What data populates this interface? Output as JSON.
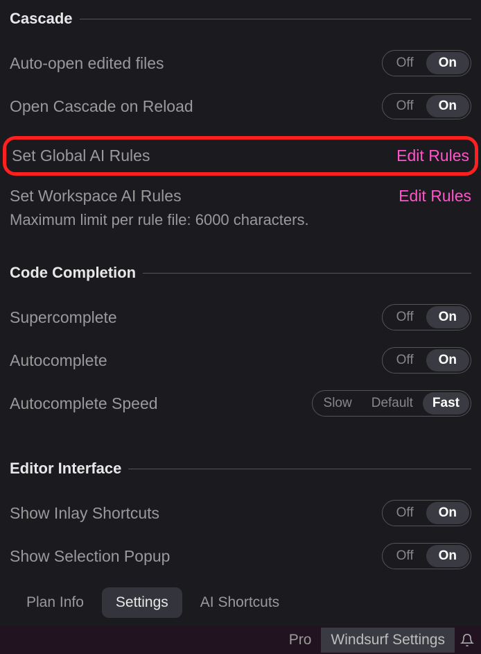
{
  "sections": {
    "cascade": {
      "title": "Cascade",
      "auto_open_label": "Auto-open edited files",
      "open_on_reload_label": "Open Cascade on Reload",
      "global_rules_label": "Set Global AI Rules",
      "global_rules_link": "Edit Rules",
      "workspace_rules_label": "Set Workspace AI Rules",
      "workspace_rules_link": "Edit Rules",
      "rules_note": "Maximum limit per rule file: 6000 characters."
    },
    "code_completion": {
      "title": "Code Completion",
      "supercomplete_label": "Supercomplete",
      "autocomplete_label": "Autocomplete",
      "speed_label": "Autocomplete Speed"
    },
    "editor_interface": {
      "title": "Editor Interface",
      "inlay_label": "Show Inlay Shortcuts",
      "selection_popup_label": "Show Selection Popup"
    }
  },
  "toggle": {
    "off": "Off",
    "on": "On"
  },
  "speed": {
    "slow": "Slow",
    "default": "Default",
    "fast": "Fast"
  },
  "tabs": {
    "plan_info": "Plan Info",
    "settings": "Settings",
    "ai_shortcuts": "AI Shortcuts"
  },
  "status": {
    "pro": "Pro",
    "windsurf": "Windsurf Settings"
  }
}
